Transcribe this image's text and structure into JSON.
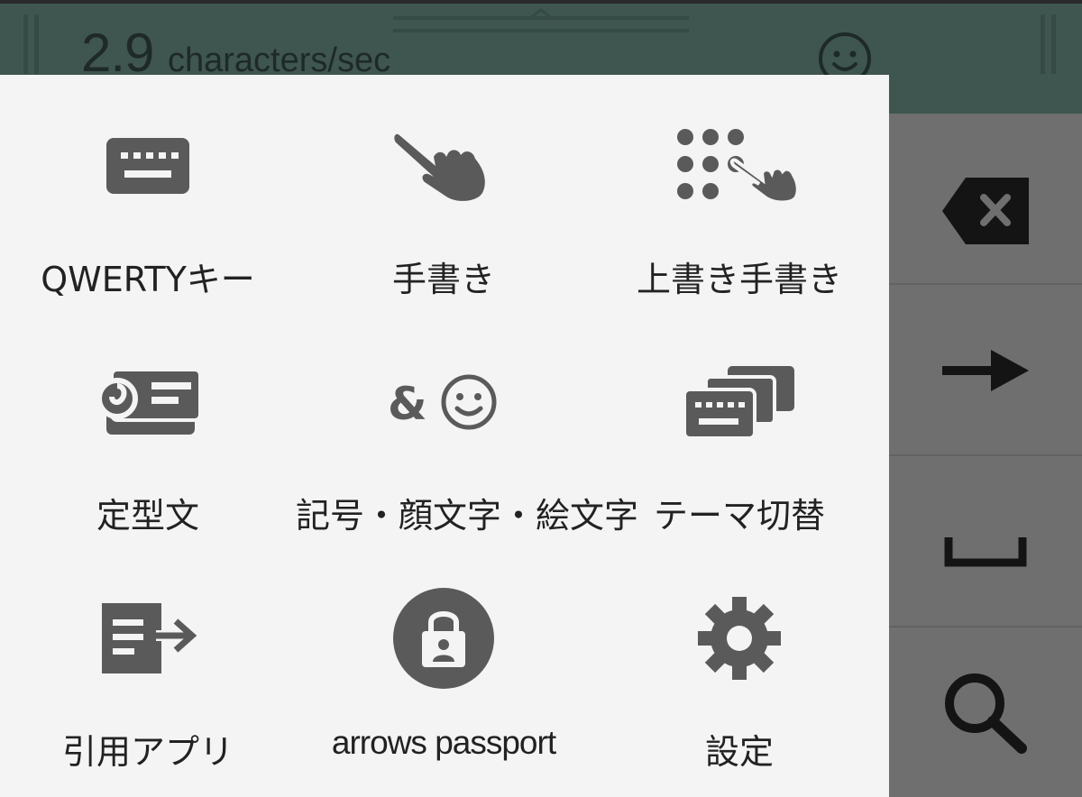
{
  "status_bar": {
    "speed_value": "2.9",
    "speed_unit": "characters/sec",
    "emoji_icon": "smiley-face-icon"
  },
  "menu": {
    "items": [
      {
        "label": "QWERTYキー",
        "icon": "keyboard-icon"
      },
      {
        "label": "手書き",
        "icon": "hand-pointer-icon"
      },
      {
        "label": "上書き手書き",
        "icon": "dot-grid-hand-icon"
      },
      {
        "label": "定型文",
        "icon": "clipboard-text-icon"
      },
      {
        "label": "記号・顔文字・絵文字",
        "icon": "ampersand-smiley-icon"
      },
      {
        "label": "テーマ切替",
        "icon": "stacked-keyboards-icon"
      },
      {
        "label": "引用アプリ",
        "icon": "document-export-icon"
      },
      {
        "label": "arrows passport",
        "icon": "padlock-user-icon"
      },
      {
        "label": "設定",
        "icon": "gear-icon"
      }
    ]
  },
  "side_keys": [
    {
      "icon": "backspace-icon"
    },
    {
      "icon": "arrow-right-icon"
    },
    {
      "icon": "space-icon"
    },
    {
      "icon": "search-icon"
    }
  ],
  "colors": {
    "panel_bg": "#f4f4f4",
    "icon": "#5a5a5a",
    "overlay_top": "#3f5550",
    "overlay_side": "#6f6f6f"
  }
}
